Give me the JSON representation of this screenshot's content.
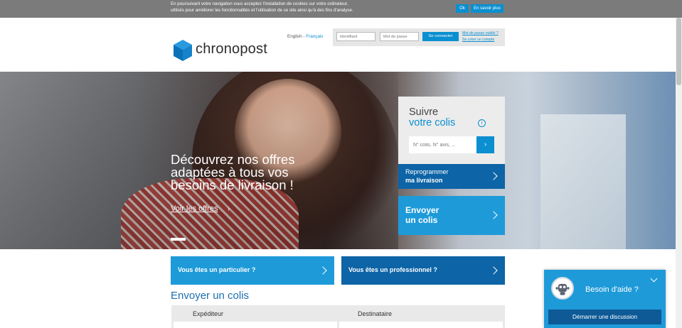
{
  "cookie_bar": {
    "text_line1": "En poursuivant votre navigation vous acceptez l'installation de cookies sur votre ordinateur,",
    "text_line2": "utilisés pour améliorer les fonctionnalités et l'utilisation de ce site ainsi qu'à des fins d'analyse.",
    "ok_label": "Ok",
    "more_label": "En savoir plus"
  },
  "header": {
    "logo_text": "chronopost",
    "lang_english": "English",
    "lang_sep": " - ",
    "lang_french": "Français",
    "login": {
      "id_placeholder": "Identifiant",
      "pw_placeholder": "Mot de passe",
      "connect_label": "Se connecter",
      "forgot_label": "Mot de passe oublié ?",
      "create_label": "Se créer un compte"
    }
  },
  "hero": {
    "headline": "Découvrez nos offres adaptées à tous vos besoins de livraison !",
    "cta": "Voir les offres",
    "cta_arrow": "›"
  },
  "tracking": {
    "title_line1": "Suivre",
    "title_line2": "votre colis",
    "info_icon": "i",
    "input_placeholder": "N° colis, N° avis, ...",
    "go_label": "›"
  },
  "reschedule": {
    "line1": "Reprogrammer",
    "line2": "ma livraison"
  },
  "send_panel": {
    "line1": "Envoyer",
    "line2": "un colis"
  },
  "audience": {
    "particulier": "Vous êtes un particulier ?",
    "professionnel": "Vous êtes un professionnel ?"
  },
  "send_section": {
    "title": "Envoyer un colis",
    "expediteur": "Expéditeur",
    "destinataire": "Destinataire"
  },
  "chat": {
    "title": "Besoin d'aide ?",
    "start_label": "Démarrer une discussion"
  },
  "colors": {
    "brand_blue": "#0a8fd0",
    "dark_blue": "#0d64a6",
    "light_blue": "#1e9ad9"
  }
}
